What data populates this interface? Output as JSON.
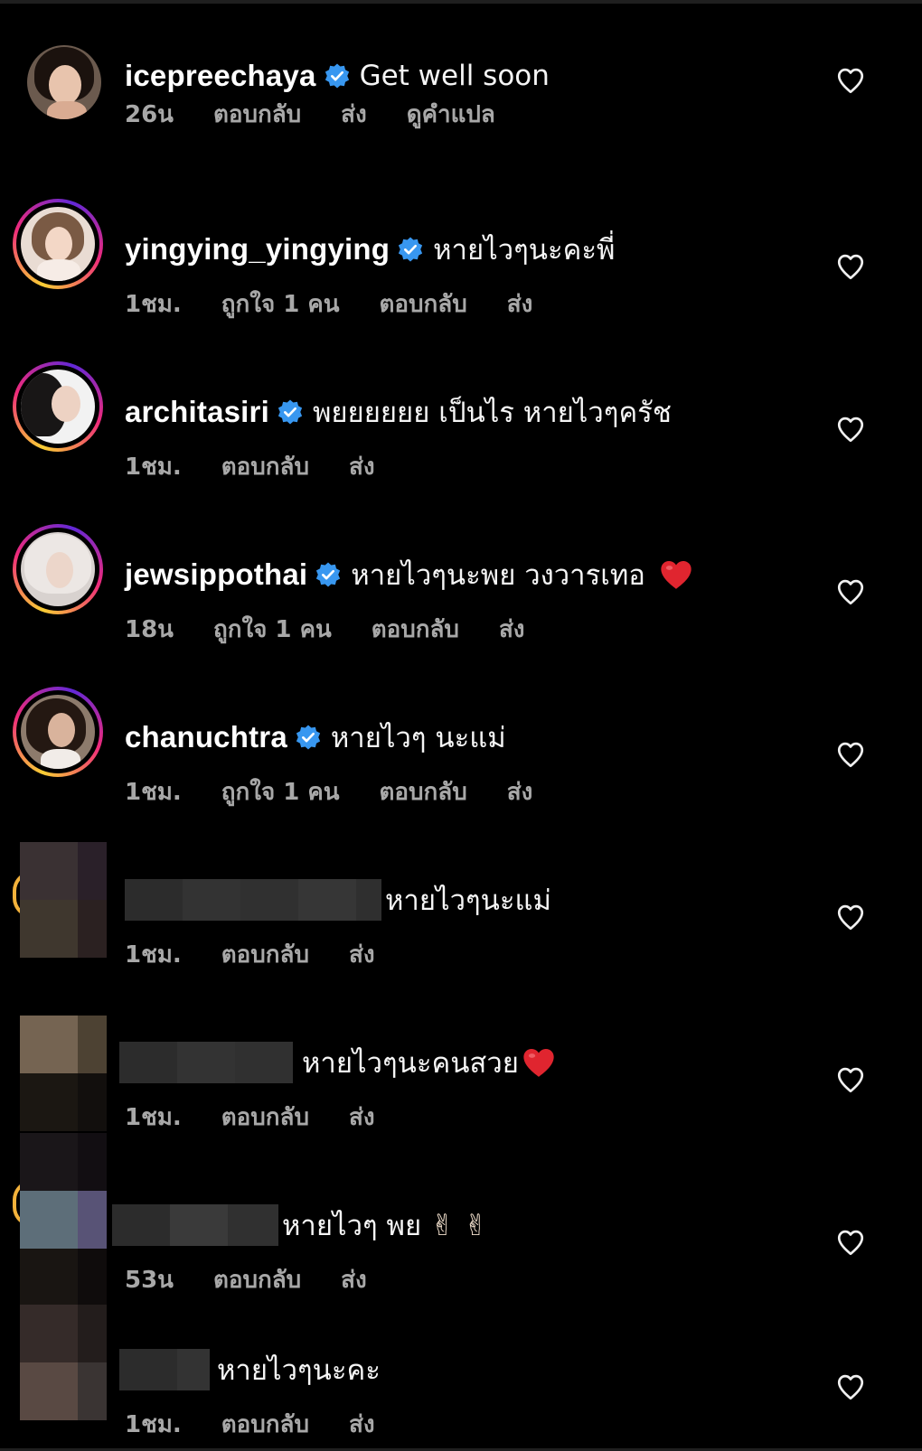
{
  "labels": {
    "reply": "ตอบกลับ",
    "send": "ส่ง",
    "translate": "ดูคำแปล",
    "one_like": "ถูกใจ 1 คน"
  },
  "icons": {
    "verified": "verified-badge-icon",
    "like": "heart-outline-icon",
    "heart_emoji": "red-heart-emoji",
    "peace_emoji": "victory-hand-emoji"
  },
  "colors": {
    "background": "#000000",
    "meta_text": "#a8a8a8",
    "verified_blue": "#3897f0",
    "heart_red": "#e0252f"
  },
  "comments": [
    {
      "username": "icepreechaya",
      "verified": true,
      "text": "Get well soon",
      "time": "26น",
      "likes": "",
      "show_translate": true
    },
    {
      "username": "yingying_yingying",
      "verified": true,
      "text": "หายไวๆนะคะพี่",
      "time": "1ชม.",
      "likes": "ถูกใจ 1 คน"
    },
    {
      "username": "architasiri",
      "verified": true,
      "text": "พยยยยยย เป็นไร หายไวๆครัช",
      "time": "1ชม.",
      "likes": ""
    },
    {
      "username": "jewsippothai",
      "verified": true,
      "text": "หายไวๆนะพย วงวารเทอ",
      "time": "18น",
      "likes": "ถูกใจ 1 คน"
    },
    {
      "username": "chanuchtra",
      "verified": true,
      "text": "หายไวๆ นะแม่",
      "time": "1ชม.",
      "likes": "ถูกใจ 1 คน"
    },
    {
      "username": "",
      "verified": false,
      "text": "หายไวๆนะแม่",
      "time": "1ชม.",
      "likes": ""
    },
    {
      "username": "",
      "verified": false,
      "text": "หายไวๆนะคนสวย",
      "time": "1ชม.",
      "likes": ""
    },
    {
      "username": "",
      "verified": false,
      "text": "หายไวๆ พย",
      "time": "53น",
      "likes": ""
    },
    {
      "username": "",
      "verified": false,
      "text": "หายไวๆนะคะ",
      "time": "1ชม.",
      "likes": ""
    }
  ]
}
